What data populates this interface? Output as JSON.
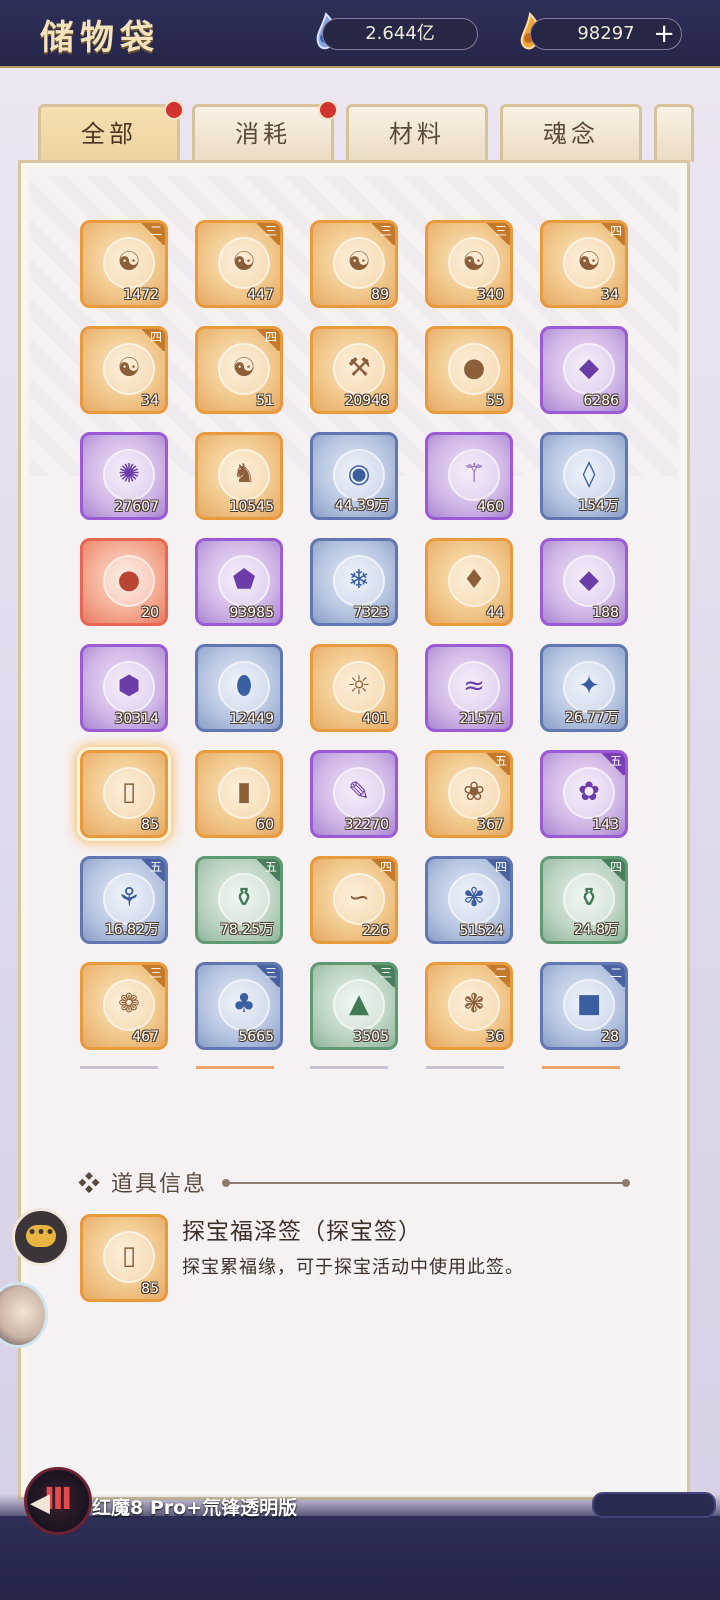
{
  "header": {
    "title": "储物袋",
    "currency1": "2.644亿",
    "currency2": "98297"
  },
  "tabs": [
    {
      "label": "全部",
      "active": true,
      "dot": true
    },
    {
      "label": "消耗",
      "active": false,
      "dot": true
    },
    {
      "label": "材料",
      "active": false,
      "dot": false
    },
    {
      "label": "魂念",
      "active": false,
      "dot": false
    }
  ],
  "items": [
    {
      "icon": "talisman-book-icon",
      "rarity": "orange",
      "count": "1472",
      "grade": "二"
    },
    {
      "icon": "talisman-book-icon",
      "rarity": "orange",
      "count": "447",
      "grade": "三"
    },
    {
      "icon": "talisman-book-icon",
      "rarity": "orange",
      "count": "89",
      "grade": "三"
    },
    {
      "icon": "talisman-book-icon",
      "rarity": "orange",
      "count": "340",
      "grade": "三"
    },
    {
      "icon": "talisman-book-icon",
      "rarity": "orange",
      "count": "34",
      "grade": "四"
    },
    {
      "icon": "talisman-book-icon",
      "rarity": "orange",
      "count": "34",
      "grade": "四"
    },
    {
      "icon": "talisman-book-icon",
      "rarity": "orange",
      "count": "51",
      "grade": "四"
    },
    {
      "icon": "scroll-icon",
      "rarity": "orange",
      "count": "20948",
      "grade": ""
    },
    {
      "icon": "fruit-icon",
      "rarity": "orange",
      "count": "55",
      "grade": ""
    },
    {
      "icon": "pink-stone-icon",
      "rarity": "purple",
      "count": "6286",
      "grade": ""
    },
    {
      "icon": "flame-orb-icon",
      "rarity": "purple",
      "count": "27607",
      "grade": ""
    },
    {
      "icon": "fox-spirit-icon",
      "rarity": "orange",
      "count": "10545",
      "grade": ""
    },
    {
      "icon": "blue-orb-icon",
      "rarity": "blue",
      "count": "44.39万",
      "grade": ""
    },
    {
      "icon": "purple-relic-icon",
      "rarity": "purple",
      "count": "460",
      "grade": ""
    },
    {
      "icon": "blue-crystal-icon",
      "rarity": "blue",
      "count": "154万",
      "grade": ""
    },
    {
      "icon": "red-orb-icon",
      "rarity": "red",
      "count": "20",
      "grade": ""
    },
    {
      "icon": "purple-ore-icon",
      "rarity": "purple",
      "count": "93985",
      "grade": ""
    },
    {
      "icon": "ice-crystal-icon",
      "rarity": "blue",
      "count": "7323",
      "grade": ""
    },
    {
      "icon": "amber-gem-icon",
      "rarity": "orange",
      "count": "44",
      "grade": ""
    },
    {
      "icon": "violet-crystal-icon",
      "rarity": "purple",
      "count": "188",
      "grade": ""
    },
    {
      "icon": "amethyst-icon",
      "rarity": "purple",
      "count": "30314",
      "grade": ""
    },
    {
      "icon": "spirit-egg-icon",
      "rarity": "blue",
      "count": "12449",
      "grade": ""
    },
    {
      "icon": "moon-sun-icon",
      "rarity": "orange",
      "count": "401",
      "grade": ""
    },
    {
      "icon": "wave-icon",
      "rarity": "purple",
      "count": "21571",
      "grade": ""
    },
    {
      "icon": "gold-crystal-icon",
      "rarity": "blue",
      "count": "26.77万",
      "grade": ""
    },
    {
      "icon": "divination-slip-icon",
      "rarity": "orange",
      "count": "85",
      "grade": "",
      "selected": true
    },
    {
      "icon": "purple-scroll-icon",
      "rarity": "orange",
      "count": "60",
      "grade": ""
    },
    {
      "icon": "herb-leaf-icon",
      "rarity": "purple",
      "count": "32270",
      "grade": ""
    },
    {
      "icon": "lily-flower-icon",
      "rarity": "orange",
      "count": "367",
      "grade": "五"
    },
    {
      "icon": "red-berry-icon",
      "rarity": "purple",
      "count": "143",
      "grade": "五"
    },
    {
      "icon": "ginseng-icon",
      "rarity": "blue",
      "count": "16.82万",
      "grade": "五"
    },
    {
      "icon": "jade-vase-icon",
      "rarity": "green",
      "count": "78.25万",
      "grade": "五"
    },
    {
      "icon": "serpent-root-icon",
      "rarity": "orange",
      "count": "226",
      "grade": "四"
    },
    {
      "icon": "blue-flower-icon",
      "rarity": "blue",
      "count": "51524",
      "grade": "四"
    },
    {
      "icon": "clay-vase-icon",
      "rarity": "green",
      "count": "24.8万",
      "grade": "四"
    },
    {
      "icon": "iris-flower-icon",
      "rarity": "orange",
      "count": "467",
      "grade": "三"
    },
    {
      "icon": "mushroom-icon",
      "rarity": "blue",
      "count": "5665",
      "grade": "三"
    },
    {
      "icon": "rock-root-icon",
      "rarity": "green",
      "count": "3505",
      "grade": "三"
    },
    {
      "icon": "lotus-icon",
      "rarity": "orange",
      "count": "36",
      "grade": "二"
    },
    {
      "icon": "white-cube-icon",
      "rarity": "blue",
      "count": "28",
      "grade": "二"
    }
  ],
  "info": {
    "heading": "❖ 道具信息",
    "name": "探宝福泽签（探宝签）",
    "description": "探宝累福缘，可于探宝活动中使用此签。",
    "count": "85"
  },
  "watermark": "红魔8 Pro+氘锋透明版"
}
